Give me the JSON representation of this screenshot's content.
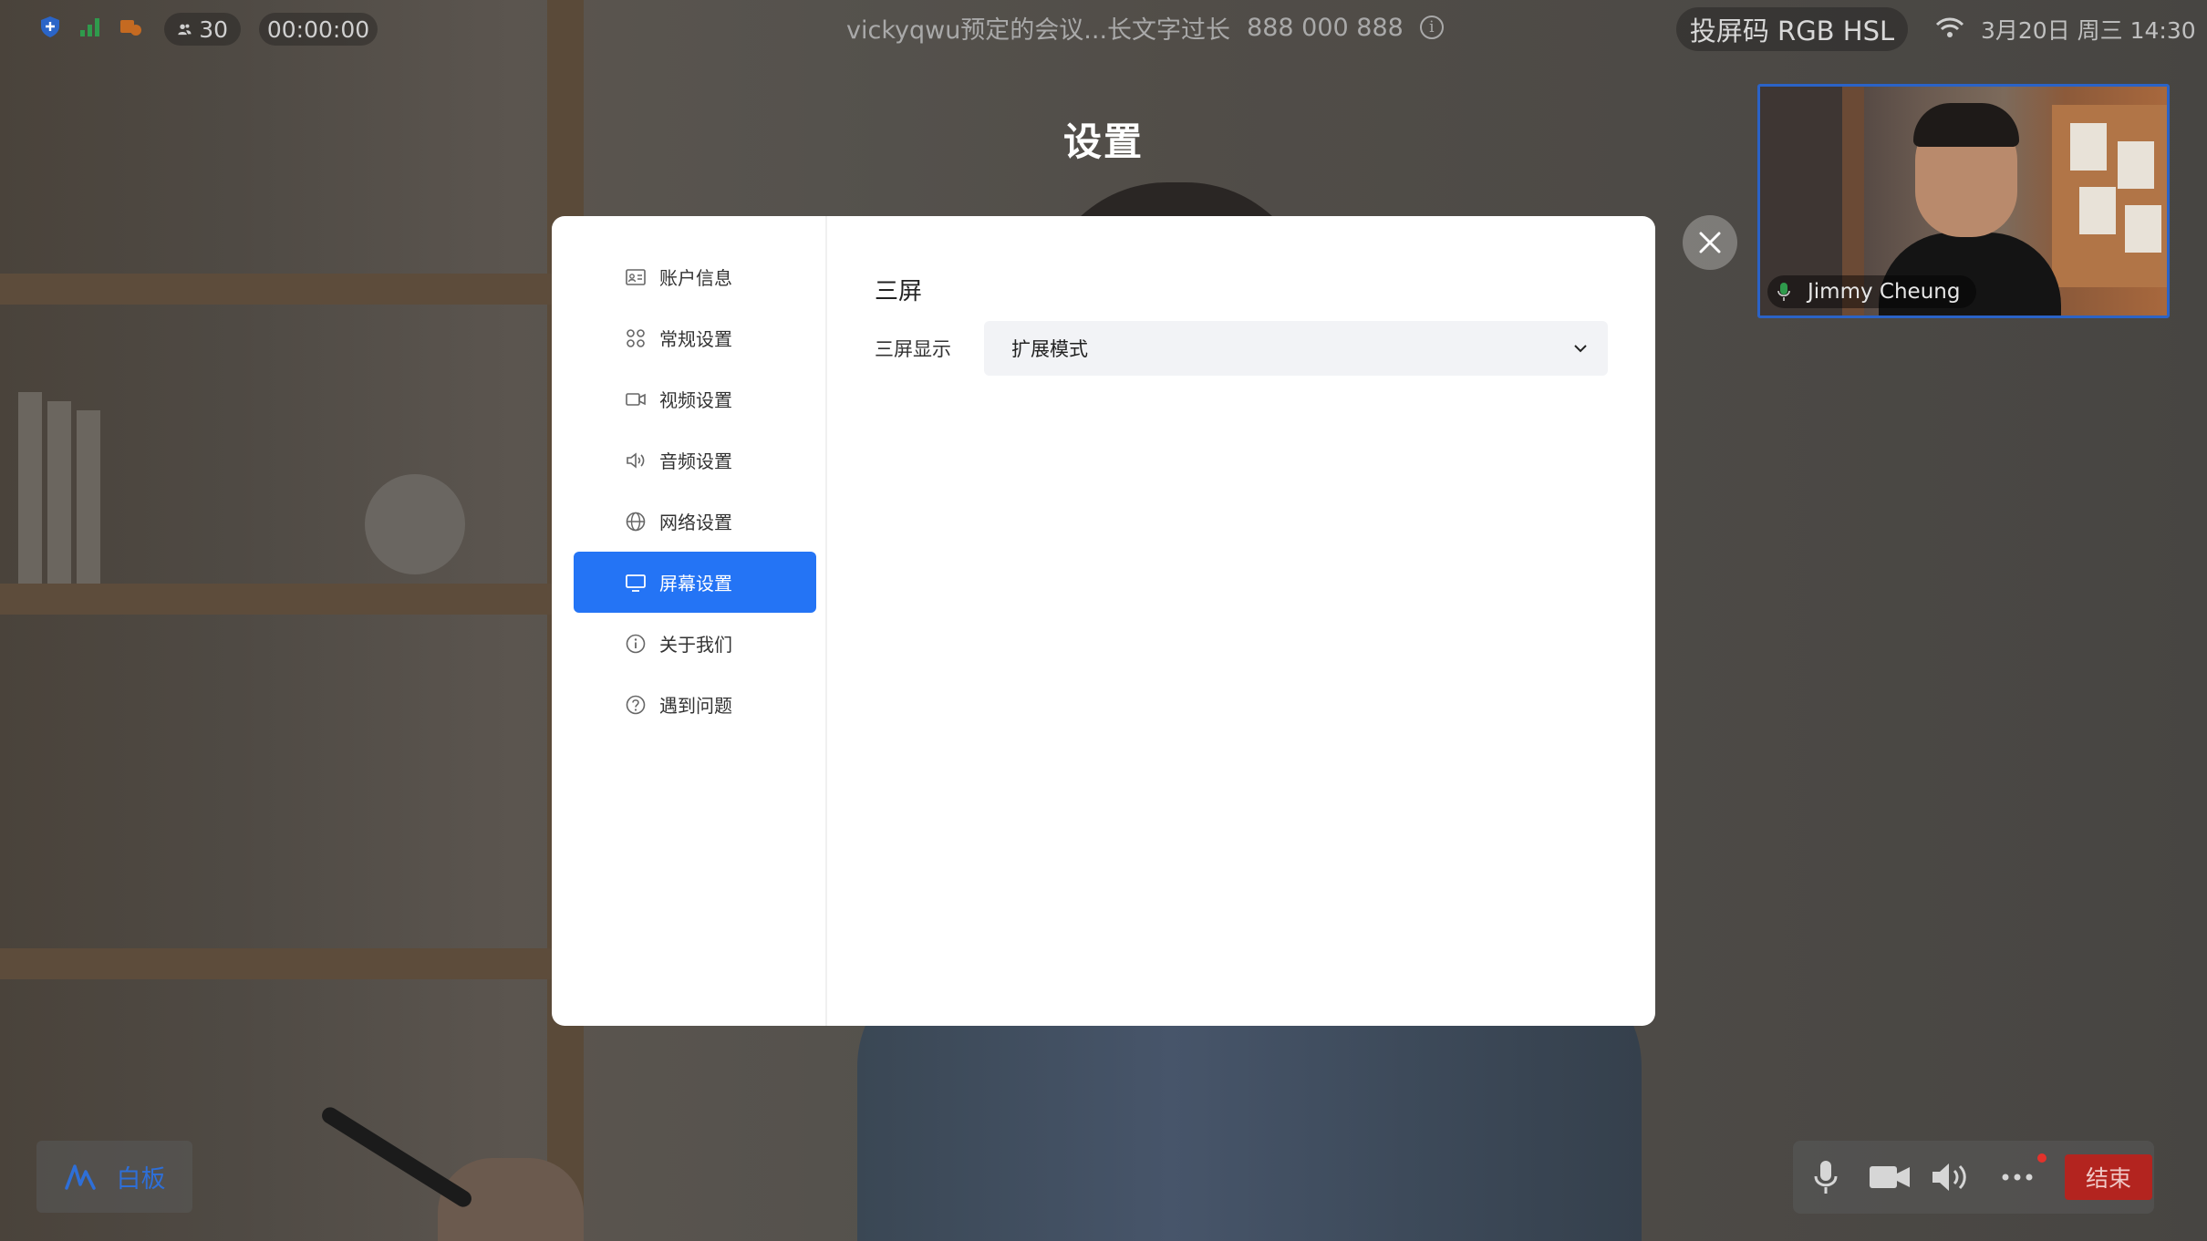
{
  "status_bar": {
    "participant_count": "30",
    "timer": "00:00:00",
    "meeting_title": "vickyqwu预定的会议...长文字过长",
    "meeting_id": "888 000 888",
    "cast_code": "投屏码 RGB HSL",
    "datetime": "3月20日 周三 14:30"
  },
  "page": {
    "title": "设置"
  },
  "video_tile": {
    "name": "Jimmy Cheung"
  },
  "settings": {
    "nav": [
      {
        "label": "账户信息",
        "icon": "account-card-icon"
      },
      {
        "label": "常规设置",
        "icon": "grid-icon"
      },
      {
        "label": "视频设置",
        "icon": "video-camera-icon"
      },
      {
        "label": "音频设置",
        "icon": "speaker-icon"
      },
      {
        "label": "网络设置",
        "icon": "globe-icon"
      },
      {
        "label": "屏幕设置",
        "icon": "monitor-icon",
        "active": true
      },
      {
        "label": "关于我们",
        "icon": "info-icon"
      },
      {
        "label": "遇到问题",
        "icon": "question-icon"
      }
    ],
    "section_title": "三屏",
    "field_label": "三屏显示",
    "select_value": "扩展模式"
  },
  "toolbar": {
    "whiteboard_label": "白板",
    "end_label": "结束"
  },
  "colors": {
    "accent": "#2474f5",
    "end_button": "#b3241f",
    "tile_border": "#2b63c7"
  }
}
